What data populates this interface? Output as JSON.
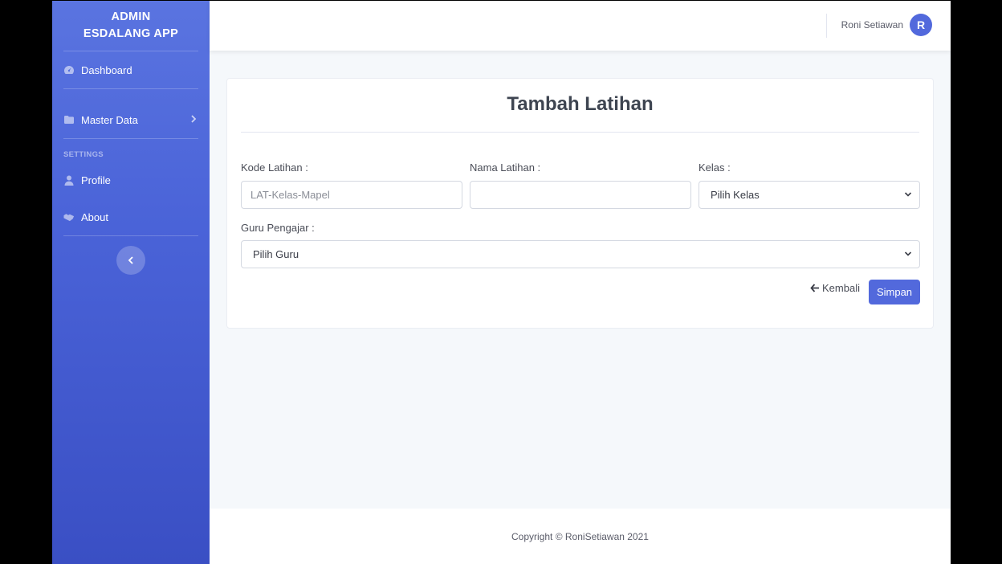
{
  "sidebar": {
    "brand_line1": "ADMIN",
    "brand_line2": "ESDALANG APP",
    "items": [
      {
        "label": "Dashboard",
        "icon": "tachometer-icon"
      },
      {
        "label": "Master Data",
        "icon": "folder-icon"
      },
      {
        "label": "Profile",
        "icon": "user-icon"
      },
      {
        "label": "About",
        "icon": "handshake-icon"
      }
    ],
    "settings_heading": "SETTINGS"
  },
  "topbar": {
    "user_name": "Roni Setiawan",
    "avatar_initial": "R"
  },
  "form": {
    "title": "Tambah Latihan",
    "kode_label": "Kode Latihan :",
    "kode_placeholder": "LAT-Kelas-Mapel",
    "nama_label": "Nama Latihan :",
    "nama_value": "",
    "kelas_label": "Kelas :",
    "kelas_value": "Pilih Kelas",
    "guru_label": "Guru Pengajar :",
    "guru_value": "Pilih Guru",
    "back_label": "Kembali",
    "save_label": "Simpan"
  },
  "footer": {
    "copyright": "Copyright © RoniSetiawan 2021"
  },
  "colors": {
    "primary": "#5269dc",
    "sidebar_top": "#5a74e0",
    "sidebar_bottom": "#3a4fc4"
  }
}
